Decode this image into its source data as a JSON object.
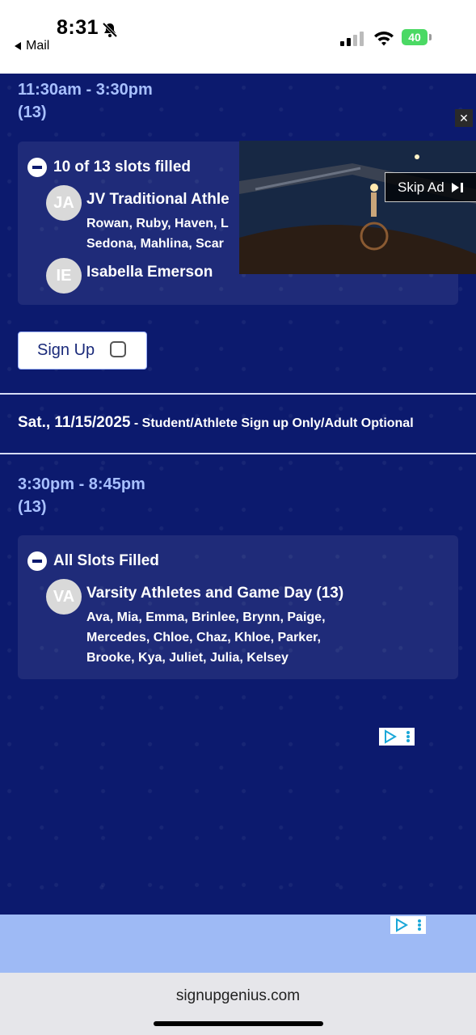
{
  "status_bar": {
    "time": "8:31",
    "back_label": "Mail",
    "battery": "40"
  },
  "section1": {
    "time_range": "11:30am - 3:30pm",
    "count": "(13)",
    "filled_status": "10 of 13 slots filled",
    "items": [
      {
        "initials": "JA",
        "name": "JV Traditional Athle",
        "names_line1": "Rowan, Ruby, Haven, L",
        "names_line2": "Sedona, Mahlina, Scar"
      },
      {
        "initials": "IE",
        "name": "Isabella Emerson"
      }
    ],
    "signup_label": "Sign Up"
  },
  "date_header": {
    "date": "Sat., 11/15/2025",
    "separator": " - ",
    "description": "Student/Athlete Sign up Only/Adult Optional"
  },
  "section2": {
    "time_range": "3:30pm - 8:45pm",
    "count": "(13)",
    "filled_status": "All Slots Filled",
    "items": [
      {
        "initials": "VA",
        "name": "Varsity Athletes and Game Day (13)",
        "names_line1": "Ava, Mia, Emma, Brinlee, Brynn, Paige,",
        "names_line2": "Mercedes, Chloe, Chaz, Khloe, Parker,",
        "names_line3": "Brooke, Kya, Juliet, Julia, Kelsey"
      }
    ]
  },
  "video_ad": {
    "close_glyph": "✕",
    "skip_label": "Skip Ad"
  },
  "browser": {
    "url": "signupgenius.com"
  },
  "icons": {
    "bell": "bell-slash-icon",
    "signal": "cellular-signal-icon",
    "wifi": "wifi-icon",
    "adchoices": "adchoices-icon"
  }
}
